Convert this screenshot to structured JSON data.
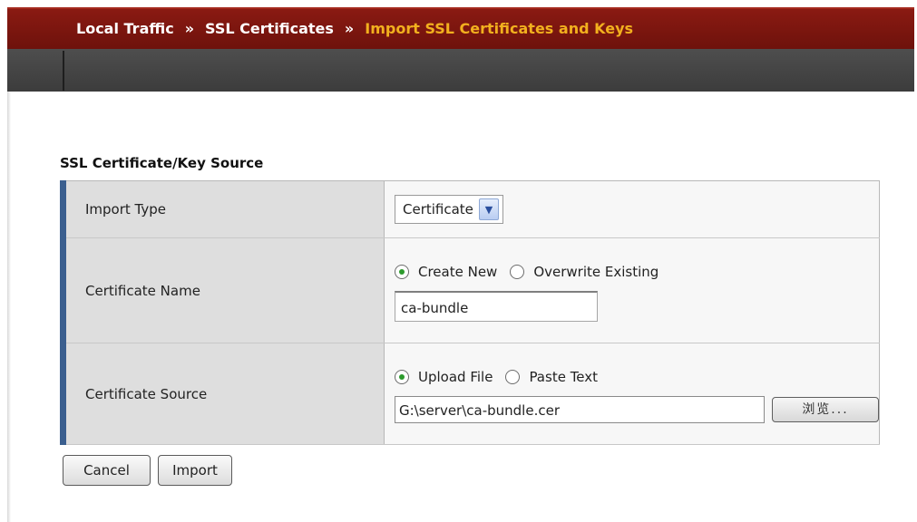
{
  "breadcrumb": {
    "items": [
      "Local Traffic",
      "SSL Certificates"
    ],
    "separator": "»",
    "current": "Import SSL Certificates and Keys"
  },
  "section": {
    "title": "SSL Certificate/Key Source"
  },
  "form": {
    "import_type": {
      "label": "Import Type",
      "selected": "Certificate"
    },
    "certificate_name": {
      "label": "Certificate Name",
      "option_create": "Create New",
      "option_overwrite": "Overwrite Existing",
      "selected_option": "Create New",
      "value": "ca-bundle"
    },
    "certificate_source": {
      "label": "Certificate Source",
      "option_upload": "Upload File",
      "option_paste": "Paste Text",
      "selected_option": "Upload File",
      "file_path": "G:\\server\\ca-bundle.cer",
      "browse_label": "浏览..."
    }
  },
  "actions": {
    "cancel_label": "Cancel",
    "import_label": "Import"
  },
  "colors": {
    "header_red": "#7d1710",
    "breadcrumb_current": "#f2b01e",
    "subbar_gray": "#454545",
    "label_accent_blue": "#3b5f8f",
    "radio_checked_green": "#2c9a2c"
  }
}
